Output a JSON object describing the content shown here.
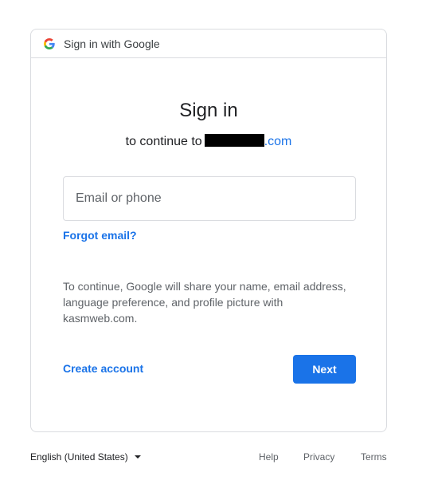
{
  "header": {
    "title": "Sign in with Google",
    "logo_icon": "google-g-icon"
  },
  "main": {
    "heading": "Sign in",
    "subtitle_prefix": "to continue to",
    "subtitle_domain_suffix": ".com",
    "email_placeholder": "Email or phone",
    "email_value": "",
    "forgot_email": "Forgot email?",
    "notice": "To continue, Google will share your name, email address, language preference, and profile picture with kasmweb.com.",
    "create_account": "Create account",
    "next": "Next"
  },
  "footer": {
    "language": "English (United States)",
    "help": "Help",
    "privacy": "Privacy",
    "terms": "Terms"
  },
  "colors": {
    "accent": "#1a73e8",
    "border": "#dadce0",
    "text": "#202124",
    "muted": "#5f6368"
  }
}
